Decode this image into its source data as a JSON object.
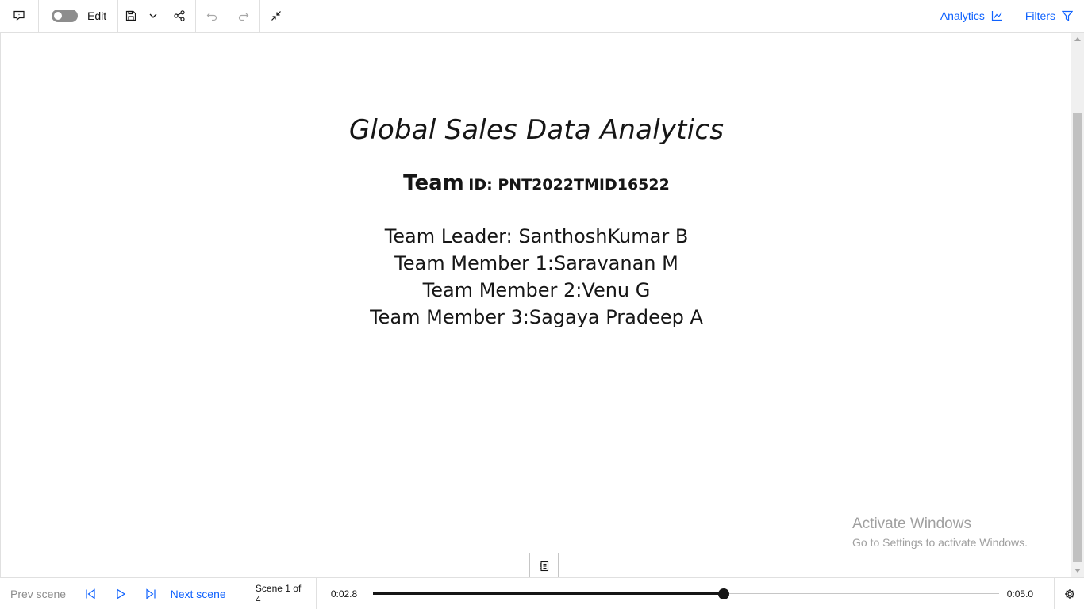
{
  "toolbar": {
    "edit_label": "Edit",
    "analytics_label": "Analytics",
    "filters_label": "Filters",
    "accent_color": "#0f62fe",
    "edit_toggle_on": false
  },
  "slide": {
    "title": "Global Sales Data Analytics",
    "team_id_prefix": "Team",
    "team_id_value": "ID: PNT2022TMID16522",
    "members": [
      "Team Leader: SanthoshKumar B",
      "Team Member 1:Saravanan M",
      "Team Member 2:Venu G",
      "Team Member 3:Sagaya Pradeep A"
    ]
  },
  "watermark": {
    "line1": "Activate Windows",
    "line2": "Go to Settings to activate Windows."
  },
  "playback": {
    "prev_label": "Prev scene",
    "next_label": "Next scene",
    "scene_counter": "Scene 1 of 4",
    "current_time": "0:02.8",
    "total_time": "0:05.0",
    "progress": 0.56
  },
  "icons": [
    "comment-icon",
    "save-icon",
    "chevron-down-icon",
    "share-icon",
    "undo-icon",
    "redo-icon",
    "collapse-icon",
    "chart-icon",
    "filter-icon",
    "notes-icon",
    "skip-back-icon",
    "play-icon",
    "skip-forward-icon",
    "settings-icon"
  ]
}
